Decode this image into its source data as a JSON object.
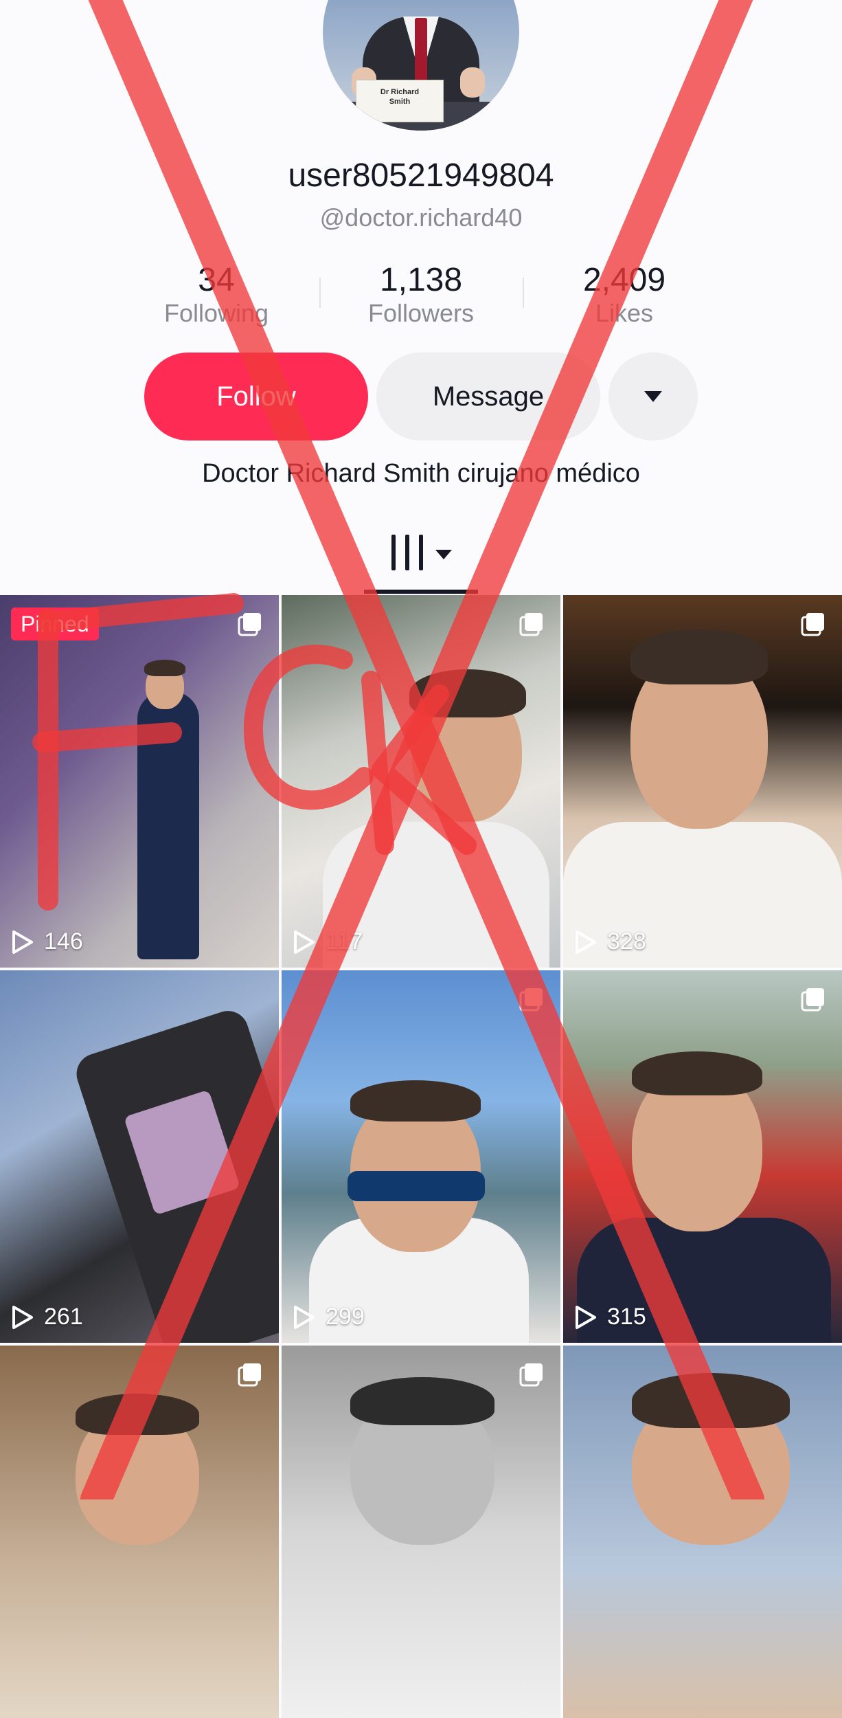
{
  "profile": {
    "nameplate_line1": "Dr Richard",
    "nameplate_line2": "Smith",
    "username": "user80521949804",
    "handle": "@doctor.richard40",
    "bio": "Doctor Richard Smith cirujano médico"
  },
  "stats": {
    "following_count": "34",
    "following_label": "Following",
    "followers_count": "1,138",
    "followers_label": "Followers",
    "likes_count": "2,409",
    "likes_label": "Likes"
  },
  "actions": {
    "follow_label": "Follow",
    "message_label": "Message",
    "more_icon": "caret-down-icon"
  },
  "tabs": {
    "videos_icon": "grid-bars-icon"
  },
  "grid": {
    "pinned_label": "Pinned",
    "videos": [
      {
        "views": "146",
        "pinned": true,
        "multi": true
      },
      {
        "views": "117",
        "pinned": false,
        "multi": true
      },
      {
        "views": "328",
        "pinned": false,
        "multi": true
      },
      {
        "views": "261",
        "pinned": false,
        "multi": false
      },
      {
        "views": "299",
        "pinned": false,
        "multi": true
      },
      {
        "views": "315",
        "pinned": false,
        "multi": true
      },
      {
        "views": "",
        "pinned": false,
        "multi": true
      },
      {
        "views": "",
        "pinned": false,
        "multi": true
      },
      {
        "views": "",
        "pinned": false,
        "multi": false
      }
    ]
  },
  "colors": {
    "accent": "#fe2c55",
    "text_primary": "#161823",
    "text_secondary": "#8a8b91",
    "button_secondary": "#efeff1",
    "overlay_mark": "#f03a3a"
  },
  "overlay": {
    "handwritten_mark": "Fck"
  }
}
